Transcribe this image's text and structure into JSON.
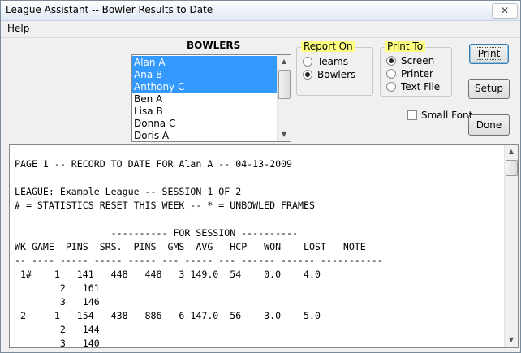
{
  "window": {
    "title": "League Assistant -- Bowler Results to Date",
    "close_glyph": "✕"
  },
  "menu": {
    "items": [
      "Help"
    ]
  },
  "bowlers": {
    "label": "BOWLERS",
    "items": [
      {
        "name": "Alan A",
        "selected": true
      },
      {
        "name": "Ana B",
        "selected": true
      },
      {
        "name": "Anthony C",
        "selected": true
      },
      {
        "name": "Ben A",
        "selected": false
      },
      {
        "name": "Lisa B",
        "selected": false
      },
      {
        "name": "Donna C",
        "selected": false
      },
      {
        "name": "Doris A",
        "selected": false
      }
    ]
  },
  "report_on": {
    "title": "Report On",
    "options": [
      {
        "label": "Teams",
        "checked": false
      },
      {
        "label": "Bowlers",
        "checked": true
      }
    ]
  },
  "print_to": {
    "title": "Print To",
    "options": [
      {
        "label": "Screen",
        "checked": true
      },
      {
        "label": "Printer",
        "checked": false
      },
      {
        "label": "Text File",
        "checked": false
      }
    ]
  },
  "buttons": {
    "print": "Print",
    "setup": "Setup",
    "done": "Done"
  },
  "small_font": {
    "label": "Small Font",
    "checked": false
  },
  "colors": {
    "selection": "#3399ff",
    "group_title_bg": "#ffff80"
  },
  "icons": {
    "scroll_up": "scroll-up-arrow-icon",
    "scroll_down": "scroll-down-arrow-icon",
    "close": "close-icon"
  },
  "report": {
    "lines": [
      "PAGE 1 -- RECORD TO DATE FOR Alan A -- 04-13-2009",
      "",
      "LEAGUE: Example League -- SESSION 1 OF 2",
      "# = STATISTICS RESET THIS WEEK -- * = UNBOWLED FRAMES",
      "",
      "                 ---------- FOR SESSION ----------",
      "WK GAME  PINS  SRS.  PINS  GMS  AVG   HCP   WON    LOST   NOTE",
      "-- ---- ----- ----- ----- --- ----- --- ------ ------ -----------",
      " 1#    1   141   448   448   3 149.0  54    0.0    4.0",
      "        2   161",
      "        3   146",
      " 2     1   154   438   886   6 147.0  56    3.0    5.0",
      "        2   144",
      "        3   140"
    ]
  }
}
